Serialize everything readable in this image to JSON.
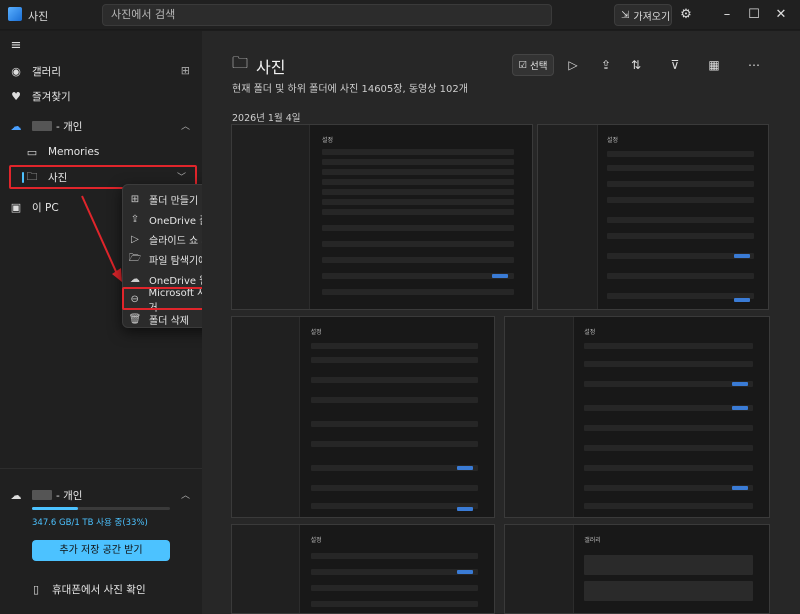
{
  "app": {
    "title": "사진"
  },
  "search": {
    "placeholder": "사진에서 검색"
  },
  "titlebar": {
    "import_label": "가져오기"
  },
  "sidebar": {
    "items": [
      {
        "label": "갤러리",
        "icon": "gallery-icon"
      },
      {
        "label": "즐겨찾기",
        "icon": "heart-icon"
      },
      {
        "label": "- 개인",
        "icon": "onedrive-cloud-icon"
      },
      {
        "label": "Memories",
        "icon": "memories-icon"
      },
      {
        "label": "사진",
        "icon": "folder-icon"
      },
      {
        "label": "이 PC",
        "icon": "pc-icon"
      }
    ]
  },
  "context_menu": {
    "items": [
      {
        "label": "폴더 만들기",
        "icon": "new-folder-icon"
      },
      {
        "label": "OneDrive 폴더 공유",
        "icon": "share-icon"
      },
      {
        "label": "슬라이드 쇼 시작",
        "icon": "slideshow-icon"
      },
      {
        "label": "파일 탐색기에서 열기",
        "icon": "folder-open-icon"
      },
      {
        "label": "OneDrive 웹에서 보기",
        "icon": "cloud-icon"
      },
      {
        "label": "Microsoft 사진 폴더 제거",
        "icon": "remove-icon"
      },
      {
        "label": "폴더 삭제",
        "icon": "trash-icon"
      }
    ]
  },
  "storage": {
    "account": "- 개인",
    "usage": "347.6 GB/1 TB 사용 중(33%)",
    "usage_fraction": 0.33,
    "cta": "추가 저장 공간 받기",
    "phone_link": "휴대폰에서 사진 확인"
  },
  "main": {
    "title": "사진",
    "subtitle": "현재 폴더 및 하위 폴더에 사진 14605장, 동영상 102개",
    "date_header": "2026년 1월 4일",
    "select_label": "선택",
    "thumbnails": [
      {
        "title": "설정"
      },
      {
        "title": "설정"
      },
      {
        "title": "설정"
      },
      {
        "title": "설정"
      },
      {
        "title": "설정"
      },
      {
        "title": "갤러리"
      }
    ]
  },
  "colors": {
    "accent": "#4cc2ff",
    "highlight": "#e0252b",
    "background": "#272727"
  }
}
